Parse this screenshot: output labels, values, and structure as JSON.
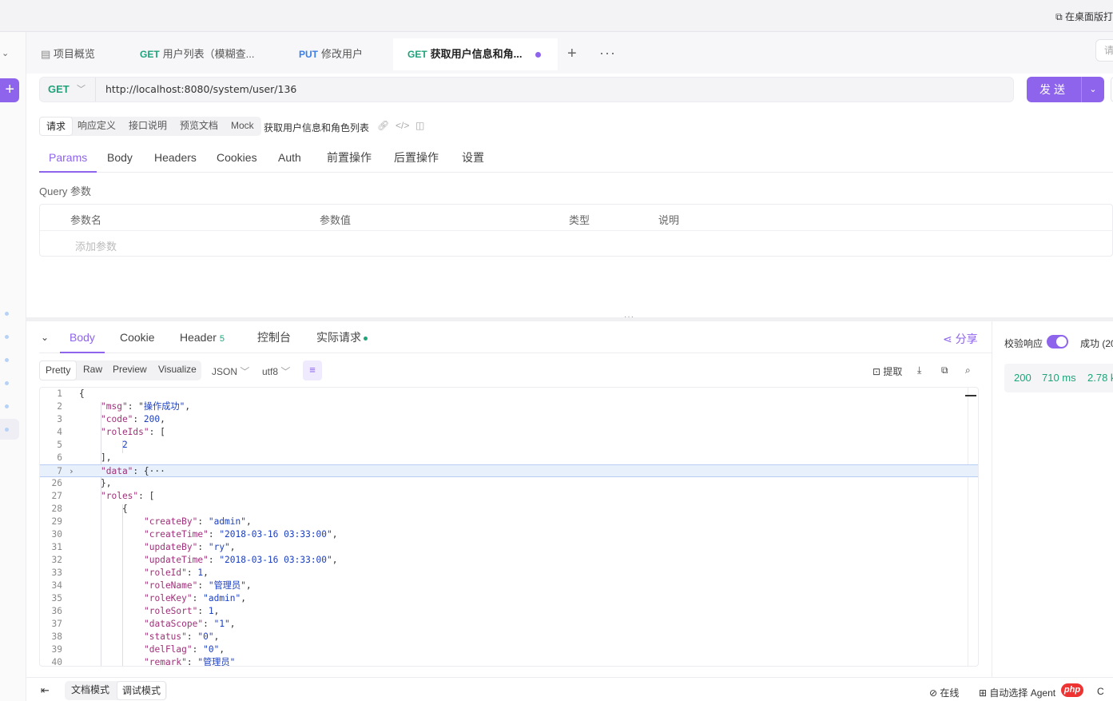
{
  "topbar": {
    "desktop_label": "在桌面版打"
  },
  "tabs": [
    {
      "method": "",
      "label": "项目概览"
    },
    {
      "method": "GET",
      "label": "用户列表（模糊查..."
    },
    {
      "method": "PUT",
      "label": "修改用户"
    },
    {
      "method": "GET",
      "label": "获取用户信息和角..."
    }
  ],
  "tab_actions": {
    "add": "+",
    "more": "···"
  },
  "right_box_text": "请",
  "request": {
    "method": "GET",
    "url": "http://localhost:8080/system/user/136",
    "send_label": "发送"
  },
  "subtabs": [
    "请求",
    "响应定义",
    "接口说明",
    "预览文档",
    "Mock"
  ],
  "request_name": "获取用户信息和角色列表",
  "param_tabs": [
    "Params",
    "Body",
    "Headers",
    "Cookies",
    "Auth",
    "前置操作",
    "后置操作",
    "设置"
  ],
  "query": {
    "label": "Query 参数",
    "columns": [
      "参数名",
      "参数值",
      "类型",
      "说明"
    ],
    "add_placeholder": "添加参数"
  },
  "response": {
    "tabs": [
      {
        "label": "Body"
      },
      {
        "label": "Cookie"
      },
      {
        "label": "Header",
        "count": "5"
      },
      {
        "label": "控制台"
      },
      {
        "label": "实际请求"
      }
    ],
    "share_label": "分享",
    "views": [
      "Pretty",
      "Raw",
      "Preview",
      "Visualize"
    ],
    "format": "JSON",
    "encoding": "utf8",
    "extract_label": "提取",
    "code_lines": [
      {
        "ln": "1",
        "indent": 0,
        "parts": [
          [
            "p",
            "{"
          ]
        ]
      },
      {
        "ln": "2",
        "indent": 1,
        "parts": [
          [
            "k",
            "\"msg\""
          ],
          [
            "p",
            ": "
          ],
          [
            "s",
            "\"操作成功\""
          ],
          [
            "p",
            ","
          ]
        ]
      },
      {
        "ln": "3",
        "indent": 1,
        "parts": [
          [
            "k",
            "\"code\""
          ],
          [
            "p",
            ": "
          ],
          [
            "n",
            "200"
          ],
          [
            "p",
            ","
          ]
        ]
      },
      {
        "ln": "4",
        "indent": 1,
        "parts": [
          [
            "k",
            "\"roleIds\""
          ],
          [
            "p",
            ": ["
          ]
        ]
      },
      {
        "ln": "5",
        "indent": 2,
        "parts": [
          [
            "n",
            "2"
          ]
        ]
      },
      {
        "ln": "6",
        "indent": 1,
        "parts": [
          [
            "p",
            "],"
          ]
        ]
      },
      {
        "ln": "7",
        "indent": 1,
        "parts": [
          [
            "k",
            "\"data\""
          ],
          [
            "p",
            ": {"
          ],
          [
            "p",
            "···"
          ]
        ],
        "highlight": true,
        "fold": true
      },
      {
        "ln": "26",
        "indent": 1,
        "parts": [
          [
            "p",
            "},"
          ]
        ]
      },
      {
        "ln": "27",
        "indent": 1,
        "parts": [
          [
            "k",
            "\"roles\""
          ],
          [
            "p",
            ": ["
          ]
        ]
      },
      {
        "ln": "28",
        "indent": 2,
        "parts": [
          [
            "p",
            "{"
          ]
        ]
      },
      {
        "ln": "29",
        "indent": 3,
        "parts": [
          [
            "k",
            "\"createBy\""
          ],
          [
            "p",
            ": "
          ],
          [
            "s",
            "\"admin\""
          ],
          [
            "p",
            ","
          ]
        ]
      },
      {
        "ln": "30",
        "indent": 3,
        "parts": [
          [
            "k",
            "\"createTime\""
          ],
          [
            "p",
            ": "
          ],
          [
            "s",
            "\"2018-03-16 03:33:00\""
          ],
          [
            "p",
            ","
          ]
        ]
      },
      {
        "ln": "31",
        "indent": 3,
        "parts": [
          [
            "k",
            "\"updateBy\""
          ],
          [
            "p",
            ": "
          ],
          [
            "s",
            "\"ry\""
          ],
          [
            "p",
            ","
          ]
        ]
      },
      {
        "ln": "32",
        "indent": 3,
        "parts": [
          [
            "k",
            "\"updateTime\""
          ],
          [
            "p",
            ": "
          ],
          [
            "s",
            "\"2018-03-16 03:33:00\""
          ],
          [
            "p",
            ","
          ]
        ]
      },
      {
        "ln": "33",
        "indent": 3,
        "parts": [
          [
            "k",
            "\"roleId\""
          ],
          [
            "p",
            ": "
          ],
          [
            "n",
            "1"
          ],
          [
            "p",
            ","
          ]
        ]
      },
      {
        "ln": "34",
        "indent": 3,
        "parts": [
          [
            "k",
            "\"roleName\""
          ],
          [
            "p",
            ": "
          ],
          [
            "s",
            "\"管理员\""
          ],
          [
            "p",
            ","
          ]
        ]
      },
      {
        "ln": "35",
        "indent": 3,
        "parts": [
          [
            "k",
            "\"roleKey\""
          ],
          [
            "p",
            ": "
          ],
          [
            "s",
            "\"admin\""
          ],
          [
            "p",
            ","
          ]
        ]
      },
      {
        "ln": "36",
        "indent": 3,
        "parts": [
          [
            "k",
            "\"roleSort\""
          ],
          [
            "p",
            ": "
          ],
          [
            "n",
            "1"
          ],
          [
            "p",
            ","
          ]
        ]
      },
      {
        "ln": "37",
        "indent": 3,
        "parts": [
          [
            "k",
            "\"dataScope\""
          ],
          [
            "p",
            ": "
          ],
          [
            "s",
            "\"1\""
          ],
          [
            "p",
            ","
          ]
        ]
      },
      {
        "ln": "38",
        "indent": 3,
        "parts": [
          [
            "k",
            "\"status\""
          ],
          [
            "p",
            ": "
          ],
          [
            "s",
            "\"0\""
          ],
          [
            "p",
            ","
          ]
        ]
      },
      {
        "ln": "39",
        "indent": 3,
        "parts": [
          [
            "k",
            "\"delFlag\""
          ],
          [
            "p",
            ": "
          ],
          [
            "s",
            "\"0\""
          ],
          [
            "p",
            ","
          ]
        ]
      },
      {
        "ln": "40",
        "indent": 3,
        "parts": [
          [
            "k",
            "\"remark\""
          ],
          [
            "p",
            ": "
          ],
          [
            "s",
            "\"管理员\""
          ]
        ]
      }
    ]
  },
  "right_panel": {
    "validate_label": "校验响应",
    "validate_on": true,
    "result_label": "成功 (20",
    "status": "200",
    "time": "710 ms",
    "size": "2.78 k"
  },
  "bottom": {
    "modes": [
      "文档模式",
      "调试模式"
    ],
    "online": "在线",
    "agent": "自动选择 Agent",
    "watermark": "php",
    "cut": "C"
  },
  "colors": {
    "accent": "#8e64ec",
    "get": "#1fa37a",
    "put": "#3a80e8"
  }
}
